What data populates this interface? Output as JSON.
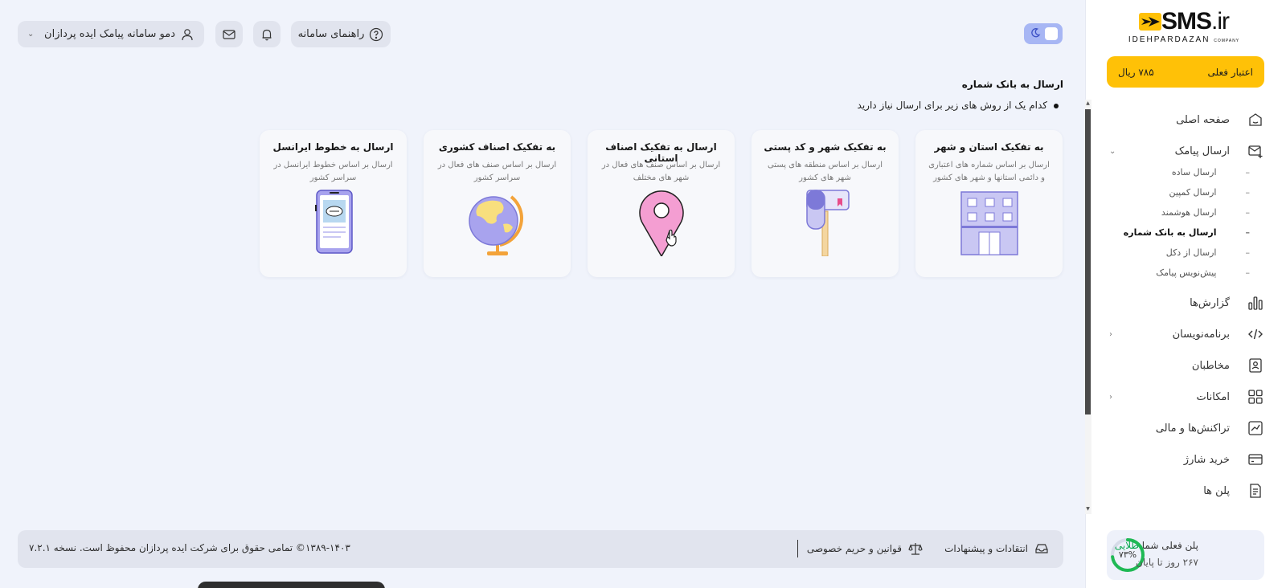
{
  "sidebar": {
    "logo": {
      "brand": "SMS",
      "tld": ".ir",
      "company": "IDEHPARDAZAN",
      "company_suffix": "COMPANY"
    },
    "credit": {
      "label": "اعتبار فعلی",
      "value": "۷۸۵ ریال"
    },
    "menu": {
      "home": "صفحه اصلی",
      "send_sms": "ارسال پیامک",
      "sub": [
        "ارسال ساده",
        "ارسال کمپین",
        "ارسال هوشمند",
        "ارسال به بانک شماره",
        "ارسال از دکل",
        "پیش‌نویس پیامک"
      ],
      "reports": "گزارش‌ها",
      "developer": "برنامه‌نویسان",
      "contacts": "مخاطبان",
      "features": "امکانات",
      "transactions": "تراکنش‌ها و مالی",
      "buy_charge": "خرید شارژ",
      "plans": "پلن ها"
    },
    "plan": {
      "prefix": "پلن فعلی شما",
      "name": "طلایی",
      "remaining": "۲۶۷ روز تا پایان",
      "percent_label": "۷۳%",
      "percent": 73
    }
  },
  "topbar": {
    "user": "دمو سامانه پیامک ایده پردازان",
    "help": "راهنمای سامانه"
  },
  "content": {
    "title": "ارسال به بانک شماره",
    "question": "کدام یک از روش های زیر برای ارسال نیاز دارید",
    "cards": [
      {
        "title": "به تفکیک استان و شهر",
        "desc": "ارسال بر اساس شماره های اعتباری و دائمی استانها و شهر های کشور"
      },
      {
        "title": "به تفکیک شهر و کد پستی",
        "desc": "ارسال بر اساس منطقه های پستی شهر های کشور"
      },
      {
        "title": "ارسال به تفکیک اصناف استانی",
        "desc": "ارسال بر اساس صنف های فعال در شهر های مختلف"
      },
      {
        "title": "به تفکیک اصناف کشوری",
        "desc": "ارسال بر اساس صنف های فعال در سراسر کشور"
      },
      {
        "title": "ارسال به خطوط ایرانسل",
        "desc": "ارسال بر اساس خطوط ایرانسل در سراسر کشور"
      }
    ]
  },
  "footer": {
    "feedback": "انتقادات و پیشنهادات",
    "terms": "قوانین و حریم خصوصی",
    "copyright": "۱۳۸۹-۱۴۰۳© تمامی حقوق برای شرکت ایده پردازان محفوظ است. نسخه ۷.۲.۱"
  },
  "colors": {
    "accent": "#ffc107",
    "toggle": "#a7b6f4",
    "plan_ring": "#1fb954",
    "background": "#f0f3fb"
  }
}
